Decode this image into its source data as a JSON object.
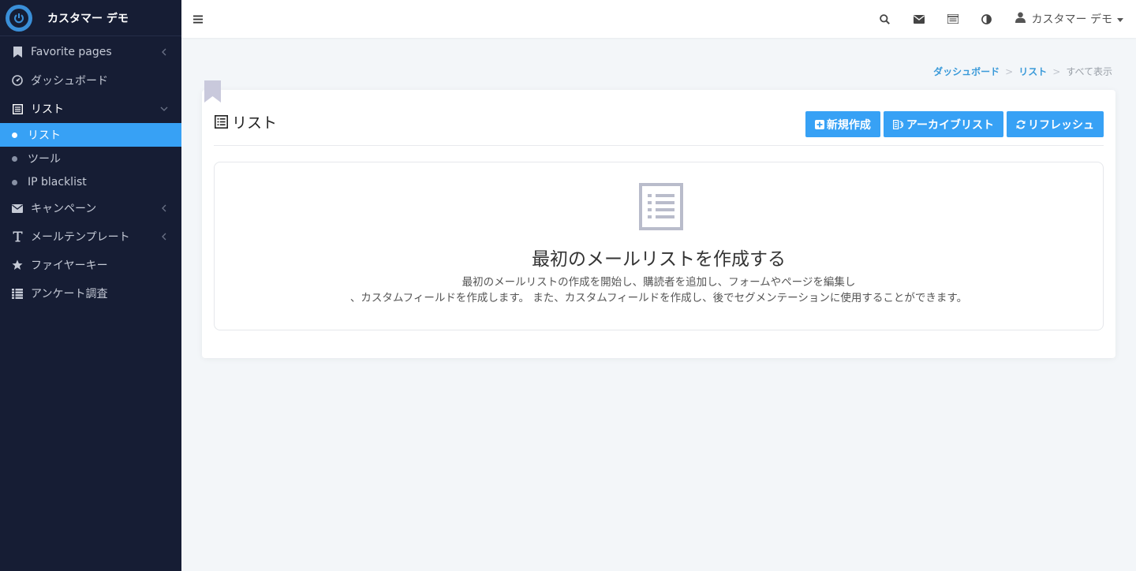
{
  "app": {
    "brand_name": "カスタマー デモ"
  },
  "sidebar": {
    "items": [
      {
        "label": "Favorite pages",
        "icon": "bookmark-icon"
      },
      {
        "label": "ダッシュボード",
        "icon": "dashboard-icon"
      },
      {
        "label": "リスト",
        "icon": "list-icon",
        "open": true,
        "children": [
          {
            "label": "リスト",
            "active": true
          },
          {
            "label": "ツール"
          },
          {
            "label": "IP blacklist"
          }
        ]
      },
      {
        "label": "キャンペーン",
        "icon": "envelope-icon"
      },
      {
        "label": "メールテンプレート",
        "icon": "text-icon"
      },
      {
        "label": "ファイヤーキー",
        "icon": "star-icon"
      },
      {
        "label": "アンケート調査",
        "icon": "survey-icon"
      }
    ]
  },
  "topbar": {
    "icons": [
      "search-icon",
      "envelope-icon",
      "list-icon",
      "contrast-icon"
    ],
    "user_name": "カスタマー デモ"
  },
  "breadcrumb": {
    "items": [
      "ダッシュボード",
      "リスト"
    ],
    "current": "すべて表示",
    "separator": ">"
  },
  "card": {
    "title": "リスト",
    "buttons": {
      "create": "新規作成",
      "archive": "アーカイブリスト",
      "refresh": "リフレッシュ"
    }
  },
  "empty_state": {
    "title": "最初のメールリストを作成する",
    "desc_line1": "最初のメールリストの作成を開始し、購読者を追加し、フォームやページを編集し",
    "desc_line2": "、カスタムフィールドを作成します。 また、カスタムフィールドを作成し、後でセグメンテーションに使用することができます。"
  },
  "colors": {
    "sidebar_bg": "#161d34",
    "accent": "#37a1f5",
    "page_bg": "#f3f6f9"
  }
}
